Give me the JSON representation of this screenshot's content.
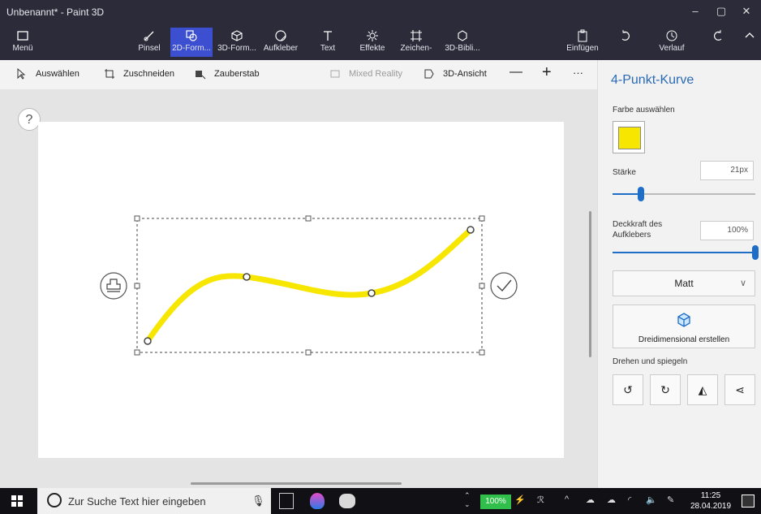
{
  "window": {
    "title": "Unbenannt* - Paint 3D",
    "controls": [
      "–",
      "▢",
      "✕"
    ]
  },
  "ribbon": {
    "menu": "Menü",
    "tools": [
      {
        "label": "Pinsel",
        "icon": "brush-icon"
      },
      {
        "label": "2D-Form...",
        "icon": "2d-shapes-icon",
        "active": true
      },
      {
        "label": "3D-Form...",
        "icon": "3d-shapes-icon"
      },
      {
        "label": "Aufkleber",
        "icon": "sticker-icon"
      },
      {
        "label": "Text",
        "icon": "text-icon"
      },
      {
        "label": "Effekte",
        "icon": "effects-icon"
      },
      {
        "label": "Zeichen-",
        "icon": "canvas-icon"
      },
      {
        "label": "3D-Bibli...",
        "icon": "3d-library-icon"
      }
    ],
    "paste": "Einfügen",
    "history": "Verlauf",
    "accent": "#3b4fd0"
  },
  "toolbar": {
    "select": "Auswählen",
    "crop": "Zuschneiden",
    "magic": "Zauberstab",
    "mixed_reality": "Mixed Reality",
    "view3d": "3D-Ansicht",
    "zoom_out": "—",
    "zoom_in": "+",
    "more": "···"
  },
  "help": "?",
  "panel": {
    "title": "4-Punkt-Kurve",
    "color_label": "Farbe auswählen",
    "color": "#f7e600",
    "thickness_label": "Stärke",
    "thickness_value": "21px",
    "thickness_fraction": 0.2,
    "opacity_label_1": "Deckkraft des",
    "opacity_label_2": "Aufklebers",
    "opacity_value": "100%",
    "opacity_fraction": 1.0,
    "finish": "Matt",
    "make3d": "Dreidimensional erstellen",
    "rotate_label": "Drehen und spiegeln",
    "accent": "#2a6ab5"
  },
  "canvas": {
    "stroke_color": "#f7e600"
  },
  "taskbar": {
    "search_placeholder": "Zur Suche Text hier eingeben",
    "battery": "100%",
    "time": "11:25",
    "date": "28.04.2019"
  }
}
